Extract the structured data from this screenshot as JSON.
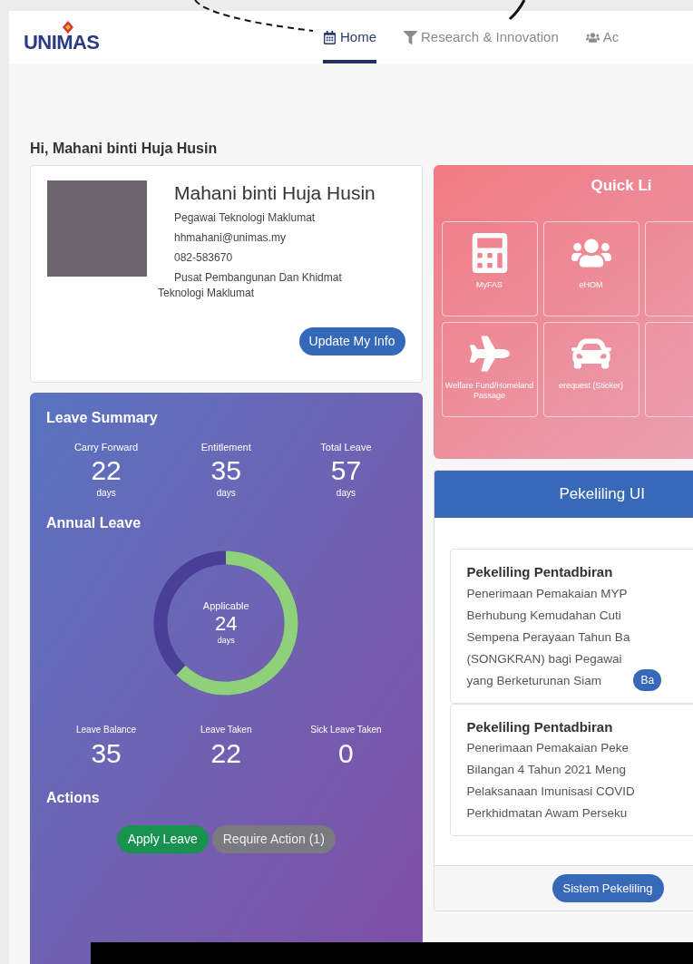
{
  "logo": {
    "text": "UNIMAS"
  },
  "nav": [
    {
      "label": "Home",
      "selected": true
    },
    {
      "label": "Research & Innovation",
      "selected": false
    },
    {
      "label": "Ac",
      "selected": false
    }
  ],
  "greeting": "Hi, Mahani binti Huja Husin",
  "profile": {
    "name": "Mahani binti Huja Husin",
    "position": "Pegawai Teknologi Maklumat",
    "email": "hhmahani@unimas.my",
    "phone": "082-583670",
    "department": "Pusat Pembangunan Dan Khidmat",
    "department_cont": "Teknologi Maklumat",
    "button": "Update My Info"
  },
  "leave_summary": {
    "title": "Leave Summary",
    "stats": [
      {
        "label": "Carry Forward",
        "value": "22",
        "unit": "days"
      },
      {
        "label": "Entitlement",
        "value": "35",
        "unit": "days"
      },
      {
        "label": "Total Leave",
        "value": "57",
        "unit": "days"
      }
    ],
    "annual_title": "Annual Leave",
    "donut": {
      "label": "Applicable",
      "value": "24",
      "unit": "days",
      "level": 0.62
    },
    "bottom_stats": [
      {
        "label": "Leave Balance",
        "value": "35"
      },
      {
        "label": "Leave Taken",
        "value": "22"
      },
      {
        "label": "Sick Leave Taken",
        "value": "0"
      }
    ],
    "actions_title": "Actions",
    "actions": [
      {
        "label": "Apply Leave",
        "kind": "primary"
      },
      {
        "label": "Require Action (1)",
        "kind": "secondary"
      }
    ]
  },
  "quick_links": {
    "title": "Quick Li",
    "tiles": [
      {
        "kind": "link",
        "label": "MyFAS"
      },
      {
        "kind": "link",
        "label": "eHOM"
      },
      {
        "kind": "blank"
      },
      {
        "kind": "link",
        "label": "Welfare Fund/Homeland Passage"
      },
      {
        "kind": "link",
        "label": "erequest (Sticker)"
      },
      {
        "kind": "blank"
      }
    ]
  },
  "circulars": {
    "title": "Pekeliling UI",
    "items": [
      {
        "title": "Pekeliling Pentadbiran",
        "lines": [
          "Penerimaan Pemakaian MYP",
          "Berhubung Kemudahan Cuti",
          "Sempena Perayaan Tahun Ba",
          "(SONGKRAN) bagi Pegawai",
          "yang Berketurunan Siam"
        ],
        "button": "Ba"
      },
      {
        "title": "Pekeliling Pentadbiran",
        "lines": [
          "Penerimaan Pemakaian Peke",
          "Bilangan 4 Tahun 2021 Meng",
          "Pelaksanaan Imunisasi COVID",
          "Perkhidmatan Awam Perseku"
        ]
      }
    ],
    "footer_button": "Sistem Pekeliling"
  }
}
